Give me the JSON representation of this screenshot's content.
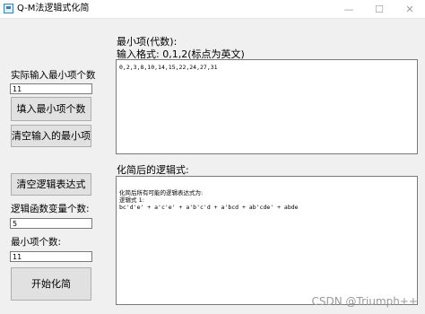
{
  "window": {
    "title": "Q-M法逻辑式化简",
    "minimize_glyph": "—",
    "maximize_glyph": "☐",
    "close_glyph": "✕"
  },
  "left_panel": {
    "actual_min_terms_label": "实际输入最小项个数",
    "actual_min_terms_value": "11",
    "fill_min_terms_button": "填入最小项个数",
    "clear_min_terms_button": "清空输入的最小项",
    "clear_expression_button": "清空逻辑表达式",
    "variable_count_label": "逻辑函数变量个数:",
    "variable_count_value": "5",
    "min_term_count_label": "最小项个数:",
    "min_term_count_value": "11",
    "start_button": "开始化简"
  },
  "min_terms_section": {
    "title": "最小项(代数):",
    "format_hint": "输入格式: 0,1,2(标点为英文)",
    "value": "0,2,3,8,10,14,15,22,24,27,31"
  },
  "result_section": {
    "title": "化简后的逻辑式:",
    "lines": [
      "化简后所有可能的逻辑表达式为:",
      "逻辑式 1:",
      "bc'd'e' + a'c'e' + a'b'c'd + a'bcd + ab'cde' + abde"
    ]
  },
  "watermark": "CSDN @Triumph++",
  "colors": {
    "window_bg": "#f0f0f0",
    "button_bg": "#e1e1e1",
    "button_border": "#adadad",
    "input_border": "#7a7a7a"
  }
}
